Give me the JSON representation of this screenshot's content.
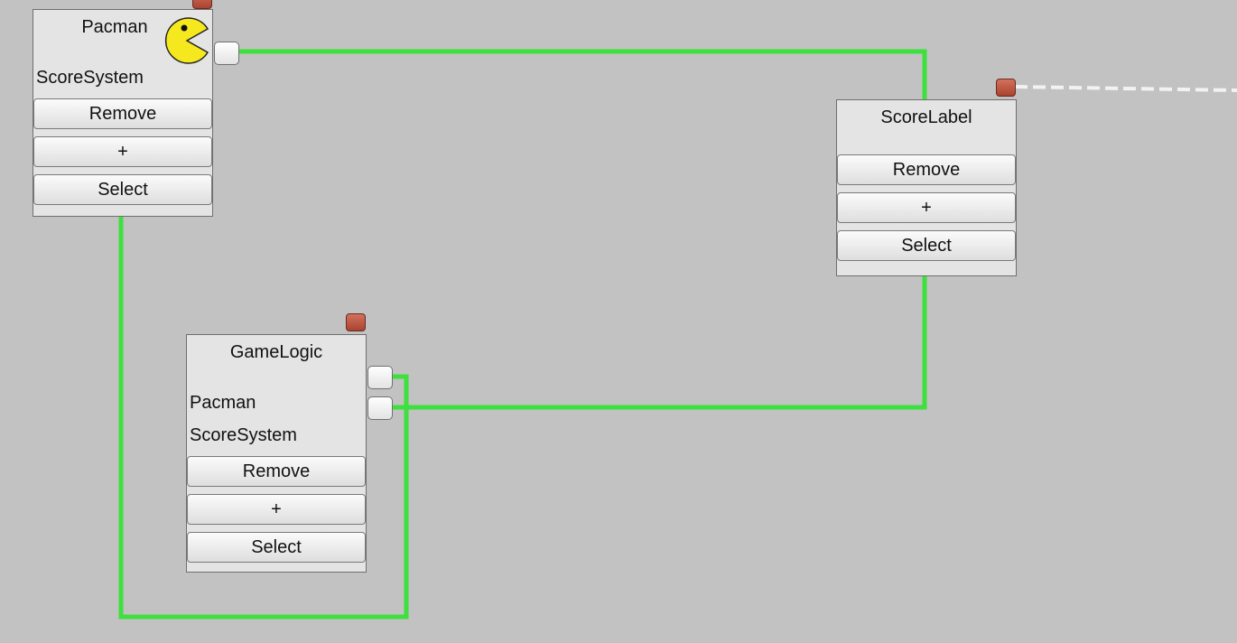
{
  "colors": {
    "canvas": "#c2c2c2",
    "node": "#e4e4e4",
    "wire": "#3ee03e",
    "close": "#b8503c",
    "dashed_wire": "#f2f2f2"
  },
  "nodes": {
    "pacman": {
      "title": "Pacman",
      "icon": "pacman-icon",
      "fields": [
        "ScoreSystem"
      ],
      "buttons": {
        "remove": "Remove",
        "add": "+",
        "select": "Select"
      }
    },
    "score_label": {
      "title": "ScoreLabel",
      "buttons": {
        "remove": "Remove",
        "add": "+",
        "select": "Select"
      }
    },
    "game_logic": {
      "title": "GameLogic",
      "fields": [
        "Pacman",
        "ScoreSystem"
      ],
      "buttons": {
        "remove": "Remove",
        "add": "+",
        "select": "Select"
      }
    }
  }
}
